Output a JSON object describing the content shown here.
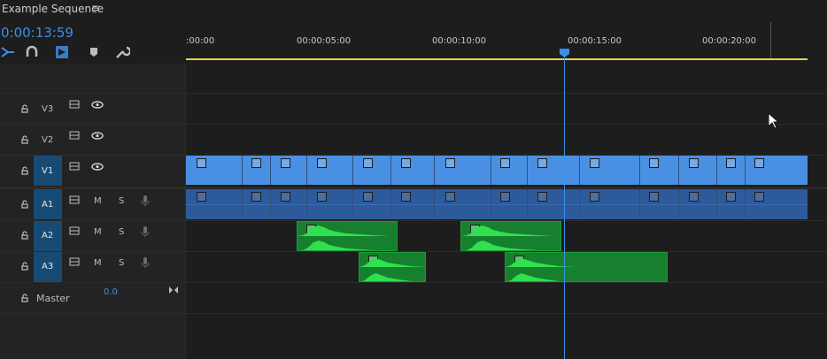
{
  "sequence": {
    "title": "Example Sequence",
    "menu_icon": "hamburger-menu-icon"
  },
  "timecode": "0:00:13:59",
  "toolbar": {
    "items": [
      "snap-icon",
      "magnet-icon",
      "linked-selection-icon",
      "add-marker-icon",
      "wrench-icon"
    ]
  },
  "ruler": {
    "ticks": [
      ":00:00",
      "00:00:05:00",
      "00:00:10:00",
      "00:00:15:00",
      "00:00:20:00"
    ]
  },
  "tracks": {
    "v3": {
      "name": "V3"
    },
    "v2": {
      "name": "V2"
    },
    "v1": {
      "name": "V1"
    },
    "a1": {
      "name": "A1",
      "m": "M",
      "s": "S"
    },
    "a2": {
      "name": "A2",
      "m": "M",
      "s": "S"
    },
    "a3": {
      "name": "A3",
      "m": "M",
      "s": "S"
    },
    "master": {
      "name": "Master",
      "value": "0.0"
    }
  },
  "colors": {
    "accent": "#3d8ee6",
    "video_clip": "#4a90e2",
    "audio_clip": "#2d5a9a",
    "audio_green": "#16802e",
    "work_area": "#e6d34d"
  }
}
